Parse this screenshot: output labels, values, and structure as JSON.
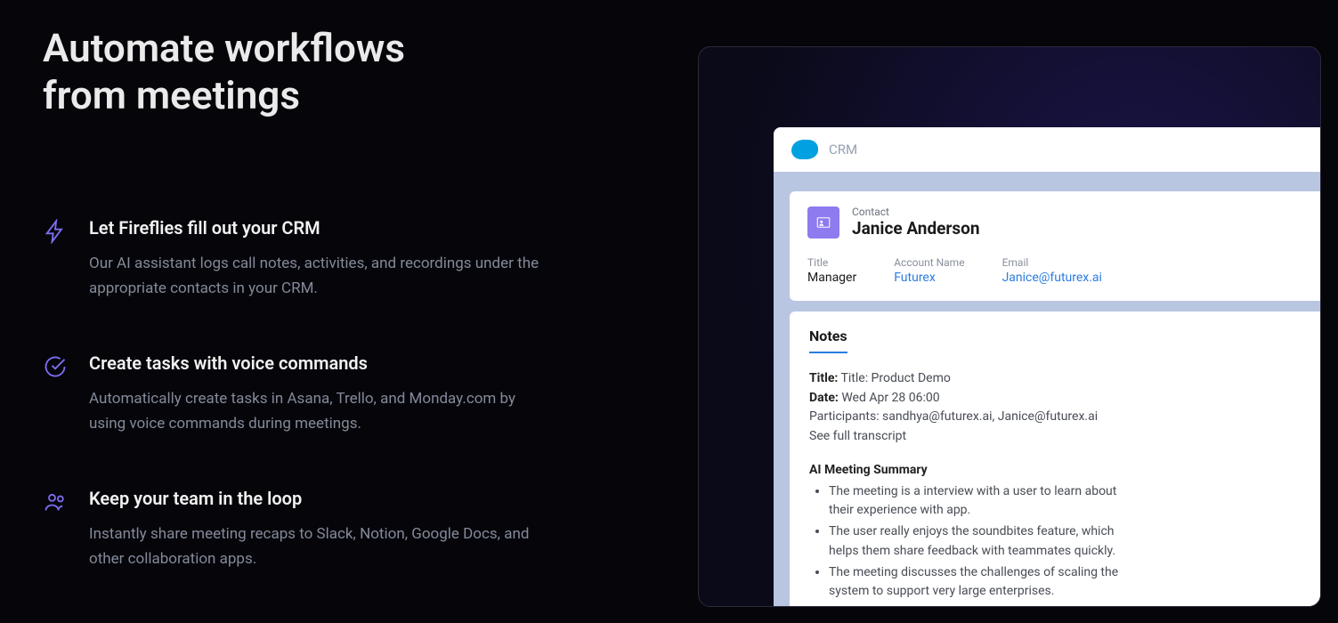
{
  "hero": {
    "title_line1": "Automate workflows",
    "title_line2": "from meetings"
  },
  "features": [
    {
      "icon": "lightning-icon",
      "title": "Let Fireflies fill out your CRM",
      "desc": "Our AI assistant logs call notes, activities, and recordings under the appropriate contacts in your CRM."
    },
    {
      "icon": "check-circle-icon",
      "title": "Create tasks with voice commands",
      "desc": "Automatically create tasks in Asana, Trello, and Monday.com by using voice commands during meetings."
    },
    {
      "icon": "people-icon",
      "title": "Keep your team in the loop",
      "desc": "Instantly share meeting recaps to Slack, Notion, Google Docs, and other collaboration apps."
    }
  ],
  "crm": {
    "app_label": "CRM",
    "contact_label": "Contact",
    "contact_name": "Janice Anderson",
    "fields": {
      "title_label": "Title",
      "title_value": "Manager",
      "account_label": "Account Name",
      "account_value": "Futurex",
      "email_label": "Email",
      "email_value": "Janice@futurex.ai"
    },
    "notes": {
      "tab_label": "Notes",
      "title_label": "Title:",
      "title_value": "Title: Product Demo",
      "date_label": "Date:",
      "date_value": "Wed Apr 28 06:00",
      "participants_line": "Participants: sandhya@futurex.ai, Janice@futurex.ai",
      "transcript_link": "See full transcript",
      "summary_heading": "AI Meeting Summary",
      "summary_items": [
        "The meeting is a interview with a user to learn about their experience with app.",
        "The user really enjoys the soundbites feature, which helps them share feedback with teammates quickly.",
        "The meeting discusses the challenges of scaling the system to support very large enterprises."
      ]
    }
  }
}
